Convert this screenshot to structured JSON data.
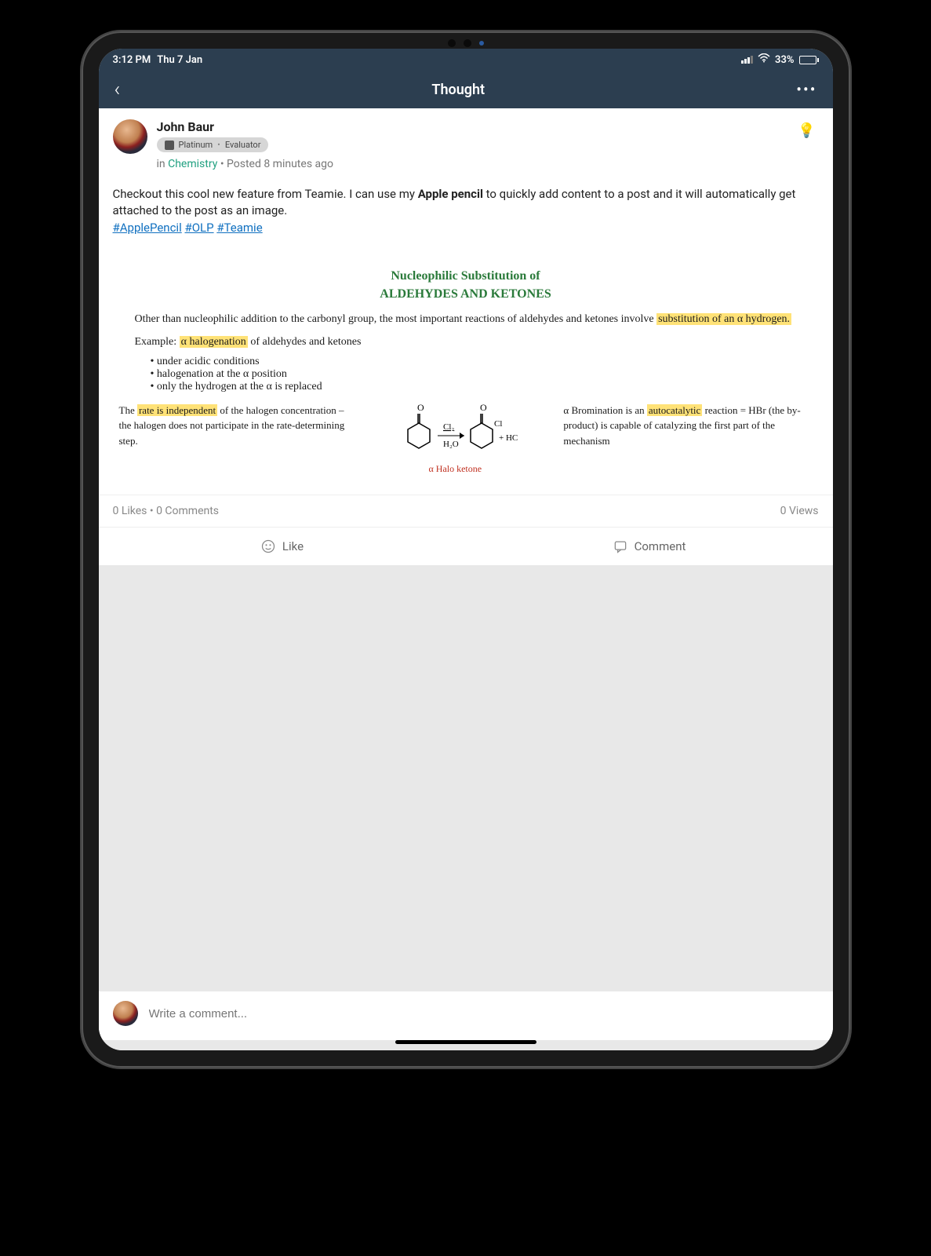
{
  "status": {
    "time": "3:12 PM",
    "date": "Thu 7 Jan",
    "battery_pct": "33%"
  },
  "nav": {
    "title": "Thought"
  },
  "post": {
    "author": "John Baur",
    "badge1": "Platinum",
    "badge2": "Evaluator",
    "in_prefix": "in ",
    "subject": "Chemistry",
    "posted": " • Posted 8 minutes ago",
    "body_before": "Checkout this cool new feature from Teamie. I can use my ",
    "body_bold": "Apple pencil",
    "body_after": " to quickly add content to a post and it will automatically get attached to the post as an image.",
    "hashtag1": "#ApplePencil",
    "hashtag2": "#OLP",
    "hashtag3": "#Teamie"
  },
  "attachment": {
    "title_line1": "Nucleophilic Substitution of",
    "title_line2": "ALDEHYDES AND KETONES",
    "p1a": "Other than nucleophilic addition to the carbonyl group, the most important reactions of aldehydes and ketones involve ",
    "p1_hl": "substitution of an α hydrogen.",
    "p2a": "Example: ",
    "p2_hl": "α halogenation",
    "p2b": " of aldehydes and ketones",
    "li1": "under acidic conditions",
    "li2": "halogenation at the α position",
    "li3": "only the hydrogen at the α is replaced",
    "col_left_a": "The ",
    "col_left_hl": "rate is independent",
    "col_left_b": " of the halogen concentration – the halogen does not participate in the rate-determining step.",
    "rx_reagent_top": "Cl₂",
    "rx_reagent_bot": "H₂O",
    "rx_product_extra": "+ HCl",
    "rx_caption": "α Halo ketone",
    "col_right_a": "α Bromination is an ",
    "col_right_hl": "autocatalytic",
    "col_right_b": " reaction = HBr (the by-product) is capable of catalyzing the first part of the mechanism"
  },
  "stats": {
    "likes": "0 Likes",
    "sep": " • ",
    "comments": "0 Comments",
    "views": "0 Views"
  },
  "actions": {
    "like": "Like",
    "comment": "Comment"
  },
  "comment_bar": {
    "placeholder": "Write a comment..."
  }
}
